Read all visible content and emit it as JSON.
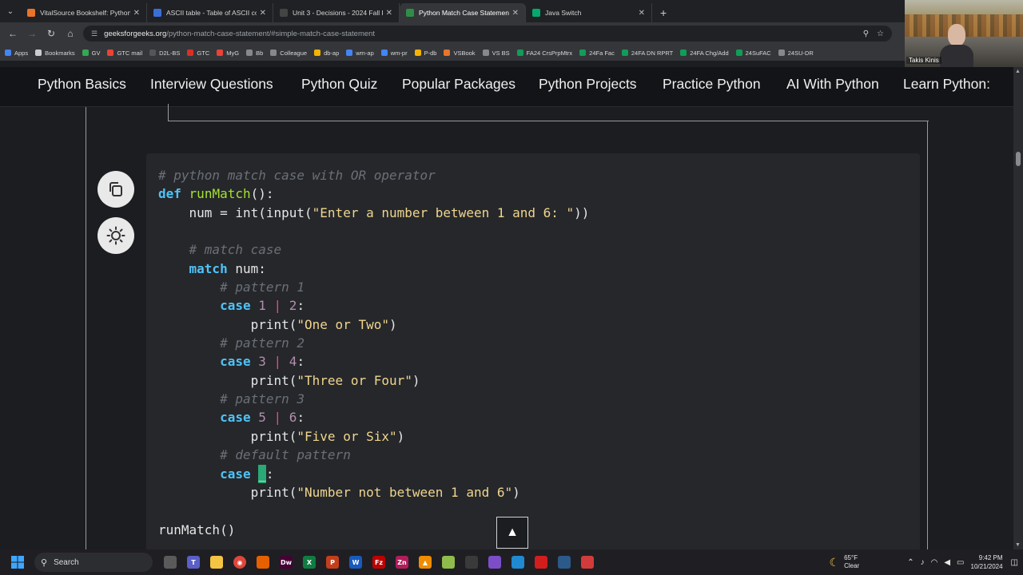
{
  "browser": {
    "tabs": [
      {
        "title": "VitalSource Bookshelf: Python f",
        "favicon_color": "#e8742b",
        "active": false
      },
      {
        "title": "ASCII table - Table of ASCII cod",
        "favicon_color": "#3b6fd8",
        "active": false
      },
      {
        "title": "Unit 3 - Decisions - 2024 Fall P",
        "favicon_color": "#444444",
        "active": false
      },
      {
        "title": "Python Match Case Statement",
        "favicon_color": "#2f8d46",
        "active": true
      },
      {
        "title": "Java Switch",
        "favicon_color": "#04aa6d",
        "active": false
      }
    ],
    "url_host": "geeksforgeeks.org",
    "url_path": "/python-match-case-statement/#simple-match-case-statement",
    "bookmarks": [
      {
        "label": "Apps",
        "color": "#4285f4"
      },
      {
        "label": "Bookmarks",
        "color": "#cccccc"
      },
      {
        "label": "GV",
        "color": "#34a853"
      },
      {
        "label": "GTC mail",
        "color": "#ea4335"
      },
      {
        "label": "D2L-BS",
        "color": "#555555"
      },
      {
        "label": "GTC",
        "color": "#d93025"
      },
      {
        "label": "MyG",
        "color": "#ea4335"
      },
      {
        "label": "Bb",
        "color": "#888888"
      },
      {
        "label": "Colleague",
        "color": "#888888"
      },
      {
        "label": "db-ap",
        "color": "#f4b400"
      },
      {
        "label": "wm-ap",
        "color": "#4285f4"
      },
      {
        "label": "wm-pr",
        "color": "#4285f4"
      },
      {
        "label": "P-db",
        "color": "#f4b400"
      },
      {
        "label": "VSBook",
        "color": "#e8742b"
      },
      {
        "label": "VS BS",
        "color": "#888888"
      },
      {
        "label": "FA24 CrsPrpMtrx",
        "color": "#0f9d58"
      },
      {
        "label": "24Fa Fac",
        "color": "#0f9d58"
      },
      {
        "label": "24FA DN RPRT",
        "color": "#0f9d58"
      },
      {
        "label": "24FA Chg/Add",
        "color": "#0f9d58"
      },
      {
        "label": "24SuFAC",
        "color": "#0f9d58"
      },
      {
        "label": "24SU-DR",
        "color": "#888888"
      }
    ]
  },
  "webcam": {
    "name": "Takis Kinis"
  },
  "site_nav": [
    "Python Basics",
    "Interview Questions",
    "Python Quiz",
    "Popular Packages",
    "Python Projects",
    "Practice Python",
    "AI With Python",
    "Learn Python:"
  ],
  "code": {
    "comment_title": "# python match case with OR operator",
    "def_kw": "def",
    "func_name": "runMatch",
    "func_sig_tail": "():",
    "line_num_prefix": "num = int(input(",
    "line_num_string": "\"Enter a number between 1 and 6: \"",
    "line_num_suffix": "))",
    "comment_match": "# match case",
    "match_kw": "match",
    "match_tail": " num:",
    "comment_p1": "# pattern 1",
    "comment_p2": "# pattern 2",
    "comment_p3": "# pattern 3",
    "comment_default": "# default pattern",
    "case_kw": "case",
    "pipe": "|",
    "colon": ":",
    "print_fn": "print(",
    "close_paren": ")",
    "p1_a": "1",
    "p1_b": "2",
    "p1_str": "\"One or Two\"",
    "p2_a": "3",
    "p2_b": "4",
    "p2_str": "\"Three or Four\"",
    "p3_a": "5",
    "p3_b": "6",
    "p3_str": "\"Five or Six\"",
    "default_wildcard": "_",
    "default_str": "\"Number not between 1 and 6\"",
    "call": "runMatch()"
  },
  "scroll_top_glyph": "▲",
  "taskbar": {
    "search_label": "Search",
    "apps": [
      {
        "name": "task-view",
        "color": "#5a5a5a",
        "glyph": ""
      },
      {
        "name": "teams",
        "color": "#5b5fc7",
        "glyph": "T"
      },
      {
        "name": "file-explorer",
        "color": "#f4c542",
        "glyph": ""
      },
      {
        "name": "chrome",
        "color": "#e0463a",
        "glyph": "◉"
      },
      {
        "name": "firefox",
        "color": "#e66000",
        "glyph": ""
      },
      {
        "name": "dreamweaver",
        "color": "#470137",
        "glyph": "Dw"
      },
      {
        "name": "excel",
        "color": "#107c41",
        "glyph": "X"
      },
      {
        "name": "powerpoint",
        "color": "#c43e1c",
        "glyph": "P"
      },
      {
        "name": "word",
        "color": "#185abd",
        "glyph": "W"
      },
      {
        "name": "filezilla",
        "color": "#bf0000",
        "glyph": "Fz"
      },
      {
        "name": "zoom",
        "color": "#b11d5b",
        "glyph": "Zn"
      },
      {
        "name": "vlc",
        "color": "#f08c00",
        "glyph": "▲"
      },
      {
        "name": "notepad-plus",
        "color": "#8fbc4a",
        "glyph": ""
      },
      {
        "name": "terminal",
        "color": "#3a3a3a",
        "glyph": ""
      },
      {
        "name": "visual-studio",
        "color": "#7b4ec8",
        "glyph": ""
      },
      {
        "name": "vscode",
        "color": "#1f8ad2",
        "glyph": ""
      },
      {
        "name": "acrobat",
        "color": "#d21d1d",
        "glyph": ""
      },
      {
        "name": "snipping-tool",
        "color": "#2b5a8a",
        "glyph": ""
      },
      {
        "name": "misc-app",
        "color": "#d23b3b",
        "glyph": ""
      }
    ],
    "weather_temp": "65°F",
    "weather_desc": "Clear",
    "time": "9:42 PM",
    "date": "10/21/2024"
  }
}
